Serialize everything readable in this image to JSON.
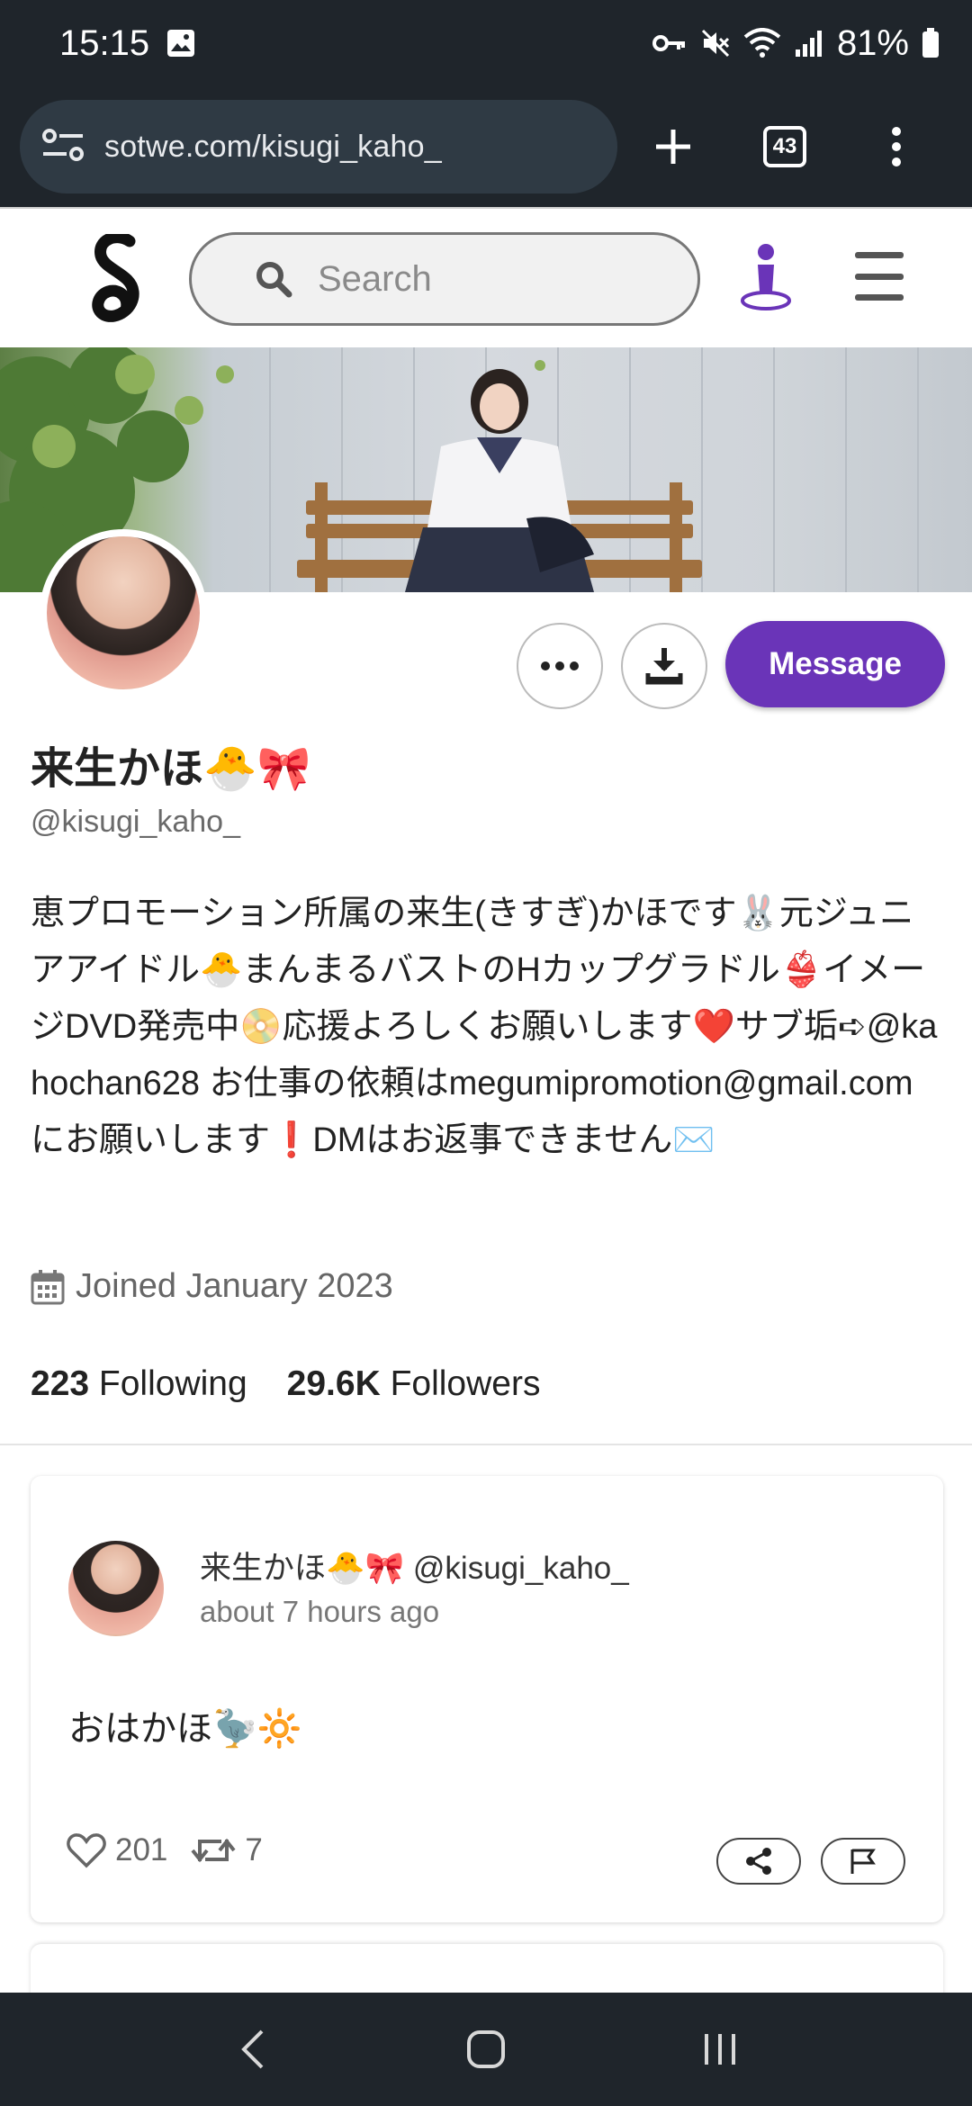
{
  "status_bar": {
    "time": "15:15",
    "battery": "81%",
    "icons": [
      "image-icon",
      "key-icon",
      "mute-icon",
      "wifi-icon",
      "signal-icon",
      "battery-icon"
    ]
  },
  "browser": {
    "url": "sotwe.com/kisugi_kaho_",
    "tab_count": "43",
    "icons": [
      "site-settings-icon",
      "new-tab-icon",
      "menu-dots-icon"
    ]
  },
  "header": {
    "search_placeholder": "Search",
    "icons": [
      "logo-icon",
      "search-icon",
      "user-icon",
      "hamburger-icon"
    ]
  },
  "profile": {
    "display_name": "来生かほ🐣🎀",
    "handle": "@kisugi_kaho_",
    "bio": "恵プロモーション所属の来生(きすぎ)かほです🐰元ジュニアアイドル🐣まんまるバストのHカップグラドル👙イメージDVD発売中📀応援よろしくお願いします❤️サブ垢➪@kahochan628 お仕事の依頼はmegumipromotion@gmail.comにお願いします❗️DMはお返事できません✉️",
    "joined": "Joined January 2023",
    "following_count": "223",
    "following_label": "Following",
    "followers_count": "29.6K",
    "followers_label": "Followers",
    "message_label": "Message"
  },
  "tweet": {
    "author": "来生かほ🐣🎀 @kisugi_kaho_",
    "time": "about 7 hours ago",
    "text": "おはかほ🦤🔆",
    "likes": "201",
    "retweets": "7"
  },
  "colors": {
    "accent": "#6a34b8",
    "system_bar": "#1f252b",
    "url_pill": "#2f3a44"
  }
}
